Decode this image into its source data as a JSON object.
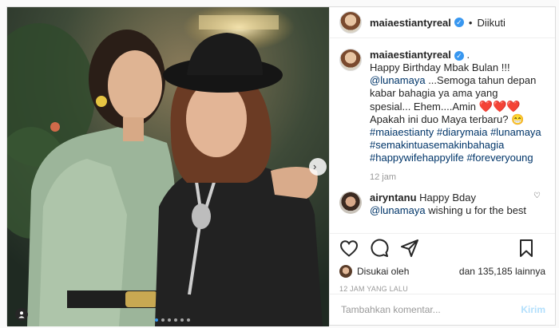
{
  "header": {
    "username": "maiaestiantyreal",
    "follow_status": "Diikuti"
  },
  "caption": {
    "username": "maiaestiantyreal",
    "dot": ".",
    "line1": "Happy Birthday Mbak Bulan !!!",
    "mention": "@lunamaya",
    "line2": " ...Semoga tahun depan kabar bahagia ya ama yang spesial... Ehem....Amin ",
    "hearts": "❤️❤️❤️",
    "line3": " Apakah ini duo Maya terbaru? ",
    "emoji": "😁",
    "hashtags": [
      "#maiaestianty",
      "#diarymaia",
      "#lunamaya",
      "#semakintuasemakinbahagia",
      "#happywifehappylife",
      "#foreveryoung"
    ],
    "time": "12 jam"
  },
  "comment": {
    "username": "airyntanu",
    "text": "Happy Bday",
    "mention": "@lunamaya",
    "text2": " wishing u for the best"
  },
  "likes": {
    "prefix": "Disukai oleh",
    "suffix": "dan 135,185 lainnya"
  },
  "timestamp": "12 JAM YANG LALU",
  "add_comment": {
    "placeholder": "Tambahkan komentar...",
    "post_label": "Kirim"
  },
  "carousel": {
    "total": 6,
    "active": 0
  },
  "colors": {
    "link": "#003569",
    "heart": "#e0202e",
    "verified": "#3897f0"
  }
}
